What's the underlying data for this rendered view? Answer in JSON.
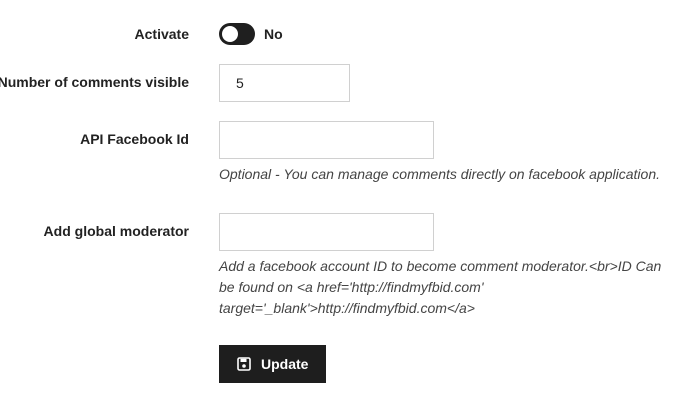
{
  "form": {
    "activate": {
      "label": "Activate",
      "state_text": "No",
      "enabled": false
    },
    "comments_visible": {
      "label": "Number of comments visible",
      "value": "5"
    },
    "api_facebook_id": {
      "label": "API Facebook Id",
      "value": "",
      "help": "Optional - You can manage comments directly on facebook application."
    },
    "global_moderator": {
      "label": "Add global moderator",
      "value": "",
      "help": "Add a facebook account ID to become comment moderator.<br>ID Can be found on <a href='http://findmyfbid.com' target='_blank'>http://findmyfbid.com</a>"
    },
    "update_button": {
      "label": "Update",
      "icon": "save-icon"
    }
  },
  "colors": {
    "button_bg": "#1e1e1e",
    "toggle_bg": "#1f1f1f",
    "input_border": "#d0d0d0"
  }
}
